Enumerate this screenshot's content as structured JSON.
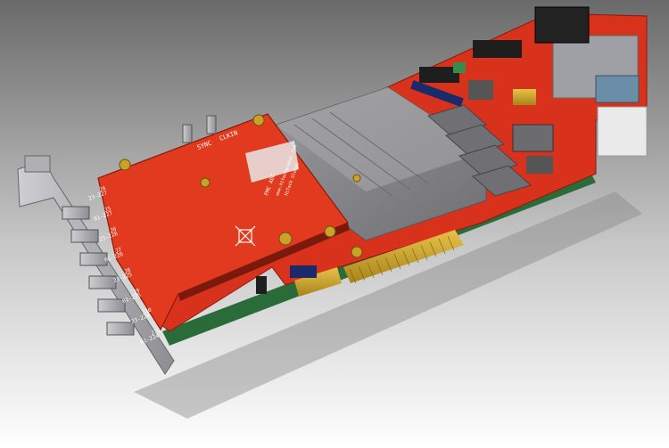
{
  "scene": {
    "background_top": "#6e6e6e",
    "background_bottom": "#ffffff",
    "pcb_color": "#d8321c",
    "mezzanine_color": "#e23a1e",
    "solder_mask_edge": "#2a6b3a",
    "gold_color": "#c9a227",
    "heatsink_color": "#8e8e92",
    "bracket_color": "#a9a9ad"
  },
  "labels": {
    "sync": "SYNC",
    "clkin": "CLKIN",
    "j4": "J4",
    "j4_sub": "23-227",
    "j5": "J5",
    "j5_sub": "01-227",
    "j6": "J6",
    "j6_sub": "23-226",
    "j7": "J7",
    "j7_sub": "01-226",
    "j8": "J8",
    "j8_sub": "23-225",
    "j9": "J9",
    "j9_sub": "01-225",
    "j10": "J10",
    "j10_sub": "23-224",
    "j11": "J11",
    "j11_sub": "01-224",
    "board_line1": "FMC ADC",
    "board_line2": "www.hitechglobal.com",
    "board_line3": "HiTech Global"
  }
}
